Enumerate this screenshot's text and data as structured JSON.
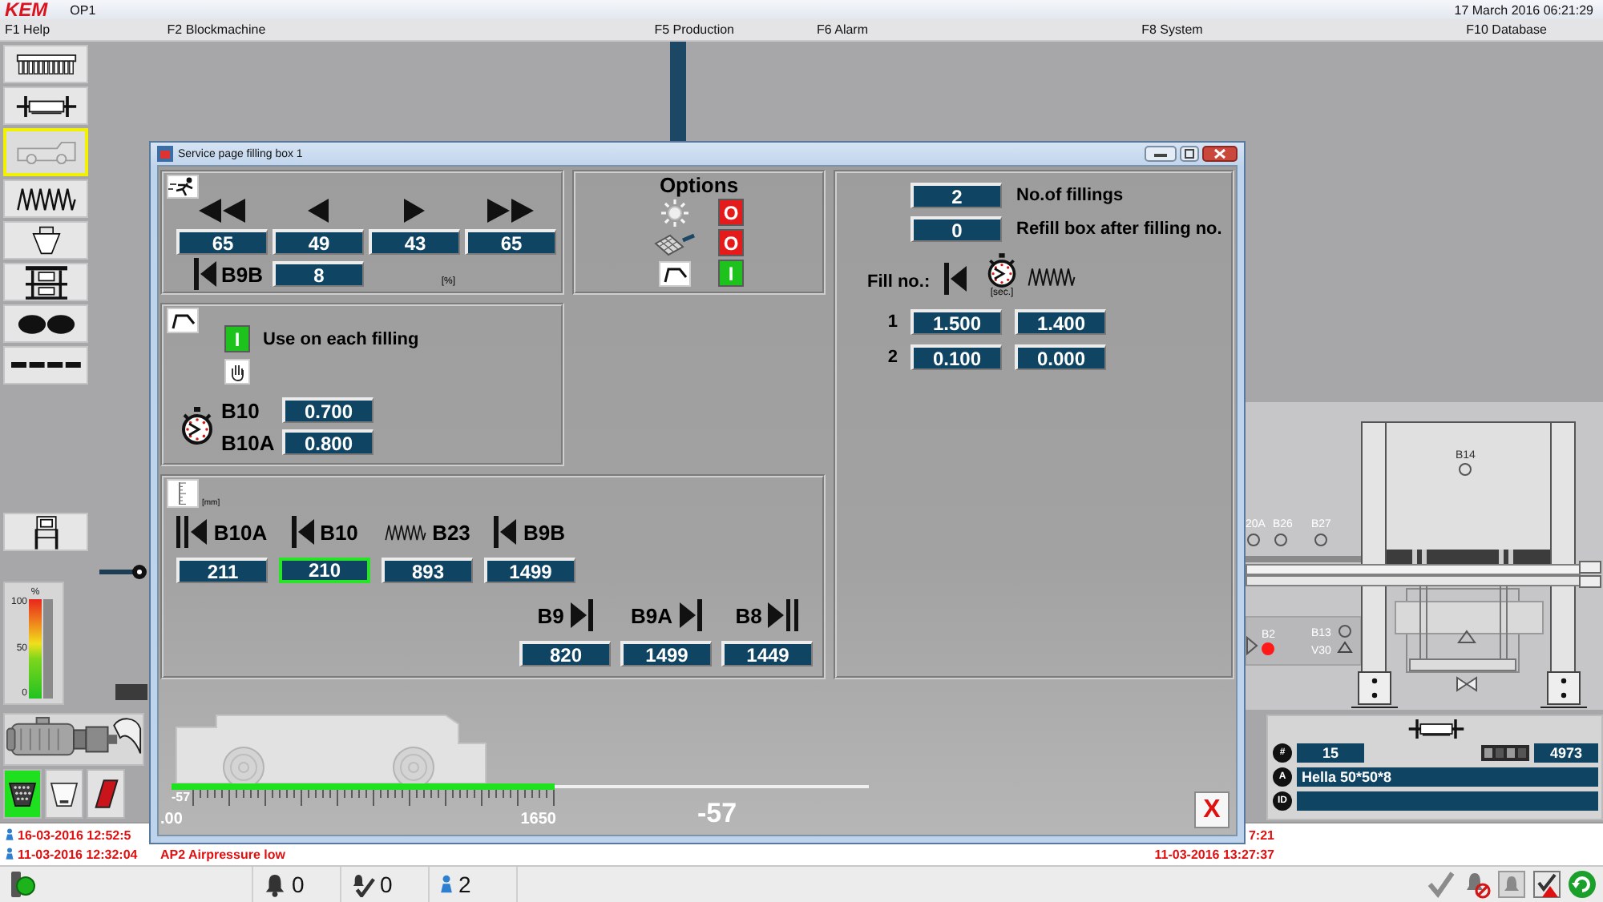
{
  "header": {
    "logo": "KEM",
    "station": "OP1",
    "datetime": "17 March 2016 06:21:29"
  },
  "menu": [
    "F1 Help",
    "F2 Blockmachine",
    "F5 Production",
    "F6 Alarm",
    "F8 System",
    "F10 Database"
  ],
  "side_buttons": [
    {
      "selected": false
    },
    {
      "selected": false
    },
    {
      "selected": true
    },
    {
      "selected": false
    },
    {
      "selected": false
    },
    {
      "selected": false
    },
    {
      "selected": false
    },
    {
      "selected": false
    },
    {
      "selected": false
    }
  ],
  "level_gauge": {
    "unit": "%",
    "ticks": [
      "100",
      "50",
      "0"
    ]
  },
  "mode_buttons": [
    {
      "selected": true
    },
    {
      "selected": false
    },
    {
      "selected": false
    }
  ],
  "machine": {
    "sensors": [
      {
        "label": "20A",
        "active": false
      },
      {
        "label": "B26",
        "active": false
      },
      {
        "label": "B27",
        "active": false
      },
      {
        "label": "B14",
        "active": false
      },
      {
        "label": "B2",
        "active": true
      },
      {
        "label": "B13",
        "active": false
      }
    ],
    "valve": "V30"
  },
  "info_panel": {
    "rows": [
      {
        "symbol": "#",
        "value": "15",
        "counter": "4973"
      },
      {
        "symbol": "A",
        "value": "Hella 50*50*8"
      },
      {
        "symbol": "ID"
      }
    ]
  },
  "alarms": [
    {
      "time": "16-03-2016 12:52:5",
      "cleared": "7:21"
    },
    {
      "time": "11-03-2016 12:32:04",
      "message": "AP2 Airpressure low",
      "cleared": "11-03-2016 13:27:37"
    }
  ],
  "status_bar": {
    "counters": [
      {
        "kind": "alarm",
        "value": "0"
      },
      {
        "kind": "acknowledged",
        "value": "0"
      },
      {
        "kind": "user",
        "value": "2"
      }
    ]
  },
  "dialog": {
    "title": "Service page filling box 1",
    "speeds": {
      "values": [
        "65",
        "49",
        "43",
        "65"
      ],
      "extra": {
        "label": "B9B",
        "value": "8"
      },
      "unit": "[%]"
    },
    "options": {
      "title": "Options",
      "switches": [
        {
          "label": "O",
          "on": false
        },
        {
          "label": "O",
          "on": false
        },
        {
          "label": "I",
          "on": true
        }
      ]
    },
    "filling": {
      "switch": {
        "label": "I",
        "on": true
      },
      "text": "Use on each filling",
      "timers": [
        {
          "label": "B10",
          "value": "0.700"
        },
        {
          "label": "B10A",
          "value": "0.800"
        }
      ]
    },
    "fill_settings": {
      "fields": [
        {
          "value": "2",
          "label": "No.of fillings"
        },
        {
          "value": "0",
          "label": "Refill box after filling no."
        }
      ],
      "table_label": "Fill no.:",
      "unit": "[sec.]",
      "rows": [
        {
          "number": "1",
          "values": [
            "1.500",
            "1.400"
          ]
        },
        {
          "number": "2",
          "values": [
            "0.100",
            "0.000"
          ]
        }
      ]
    },
    "positions": {
      "unit": "[mm]",
      "rows": [
        {
          "items": [
            {
              "label": "B10A",
              "kind": "double",
              "value": "211",
              "selected": false
            },
            {
              "label": "B10",
              "kind": "single",
              "value": "210",
              "selected": true
            },
            {
              "label": "B23",
              "kind": "spring",
              "value": "893",
              "selected": false
            },
            {
              "label": "B9B",
              "kind": "single",
              "value": "1499",
              "selected": false
            }
          ]
        },
        {
          "items": [
            {
              "label": "B9",
              "kind": "single",
              "value": "820",
              "selected": false
            },
            {
              "label": "B9A",
              "kind": "single",
              "value": "1499",
              "selected": false
            },
            {
              "label": "B8",
              "kind": "double",
              "value": "1449",
              "selected": false
            }
          ]
        }
      ]
    },
    "travel": {
      "start_label": ".00",
      "min_label": "-57",
      "max_label": "1650",
      "reading": "-57",
      "level": 0.55
    },
    "close_label": "X"
  }
}
